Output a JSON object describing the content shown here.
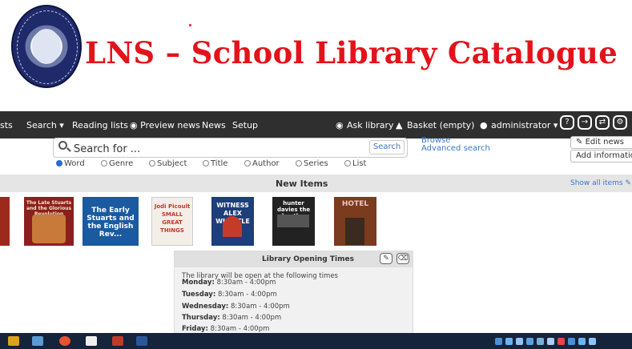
{
  "header": {
    "title": "LNS – School Library Catalogue",
    "logo_text": "THE LONDON NAUTICAL SCHOOL"
  },
  "nav": {
    "items": [
      "sts",
      "Search ▾",
      "Reading lists",
      "◉ Preview news",
      "News",
      "Setup"
    ],
    "ask_library": "Ask library",
    "basket": "Basket (empty)",
    "user": "administrator ▾"
  },
  "search": {
    "placeholder": "Search for ...",
    "button_label": "Search",
    "options": [
      "Word",
      "Genre",
      "Subject",
      "Title",
      "Author",
      "Series",
      "List"
    ],
    "selected": "Word",
    "browse_label": "Browse",
    "advanced_label": "Advanced search"
  },
  "side_buttons": {
    "edit_news": "Edit news",
    "add_information": "Add informatio"
  },
  "new_items": {
    "heading": "New Items",
    "show_all": "Show all items",
    "covers": [
      {
        "title": "The Late Stuarts and the Glorious Revolution",
        "color": "#8b1f1f"
      },
      {
        "title": "The Early Stuarts and the English Rev...",
        "color": "#1a5aa0"
      },
      {
        "title": "Jodi Picoult SMALL GREAT THINGS",
        "color": "#f3efe8"
      },
      {
        "title": "WITNESS ALEX WHEATLE",
        "color": "#1d3e7a"
      },
      {
        "title": "hunter davies the beatles",
        "color": "#222"
      },
      {
        "title": "HOTEL",
        "color": "#7a3b1e"
      }
    ]
  },
  "opening_times": {
    "title": "Library Opening Times",
    "intro": "The library will be open at the following times",
    "days": [
      {
        "day": "Monday:",
        "hours": "8:30am - 4:00pm"
      },
      {
        "day": "Tuesday:",
        "hours": "8:30am - 4:00pm"
      },
      {
        "day": "Wednesday:",
        "hours": "8:30am - 4:00pm"
      },
      {
        "day": "Thursday:",
        "hours": "8:30am - 4:00pm"
      },
      {
        "day": "Friday:",
        "hours": "8:30am - 4:00pm"
      }
    ]
  },
  "colors": {
    "title_red": "#e3131b",
    "nav_bg": "#2f2f2f",
    "link_blue": "#3a78c3",
    "taskbar_bg": "#15233b"
  }
}
